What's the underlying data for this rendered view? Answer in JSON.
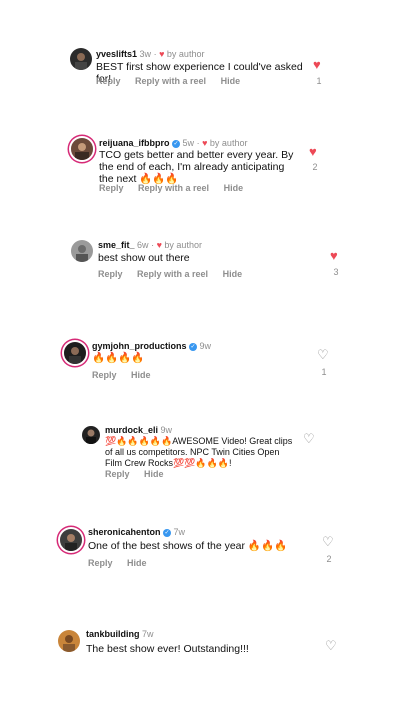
{
  "comments": [
    {
      "user": "yveslifts1",
      "time": "3w",
      "by_author": "by author",
      "text": "BEST first show experience I could've asked for!",
      "reply": "Reply",
      "reply_reel": "Reply with a reel",
      "hide": "Hide",
      "likes": "1",
      "liked": true
    },
    {
      "user": "reijuana_ifbbpro",
      "time": "5w",
      "by_author": "by author",
      "text": "TCO gets better and better every year. By the end of each, I'm already anticipating the next 🔥🔥🔥",
      "reply": "Reply",
      "reply_reel": "Reply with a reel",
      "hide": "Hide",
      "likes": "2",
      "liked": true,
      "verified": true
    },
    {
      "user": "sme_fit_",
      "time": "6w",
      "by_author": "by author",
      "text": "best show out there",
      "reply": "Reply",
      "reply_reel": "Reply with a reel",
      "hide": "Hide",
      "likes": "3",
      "liked": true
    },
    {
      "user": "gymjohn_productions",
      "time": "9w",
      "text": "🔥🔥🔥🔥",
      "reply": "Reply",
      "hide": "Hide",
      "likes": "1",
      "liked": false,
      "verified": true
    },
    {
      "user": "murdock_eli",
      "time": "9w",
      "text": "💯🔥🔥🔥🔥🔥AWESOME Video! Great clips of all us competitors.  NPC Twin Cities Open Film Crew Rocks💯💯🔥🔥🔥!",
      "reply": "Reply",
      "hide": "Hide",
      "likes": "",
      "liked": false
    },
    {
      "user": "sheronicahenton",
      "time": "7w",
      "text": "One of the best shows of the year 🔥🔥🔥",
      "reply": "Reply",
      "hide": "Hide",
      "likes": "2",
      "liked": false,
      "verified": true
    },
    {
      "user": "tankbuilding",
      "time": "7w",
      "text": "The best show ever!  Outstanding!!!",
      "likes": "",
      "liked": false
    }
  ],
  "colors": {
    "heart_on": "#ed4956",
    "muted": "#8e8e8e",
    "verified": "#3897f0",
    "story_ring": "#d62976"
  },
  "icons": {
    "like_on": "heart-filled-icon",
    "like_off": "heart-outline-icon",
    "verified": "verified-badge-icon"
  }
}
